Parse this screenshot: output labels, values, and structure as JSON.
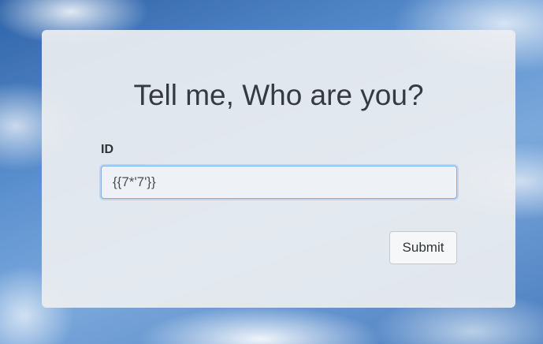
{
  "form": {
    "heading": "Tell me, Who are you?",
    "id_label": "ID",
    "id_value": "{{7*'7'}}",
    "submit_label": "Submit"
  }
}
